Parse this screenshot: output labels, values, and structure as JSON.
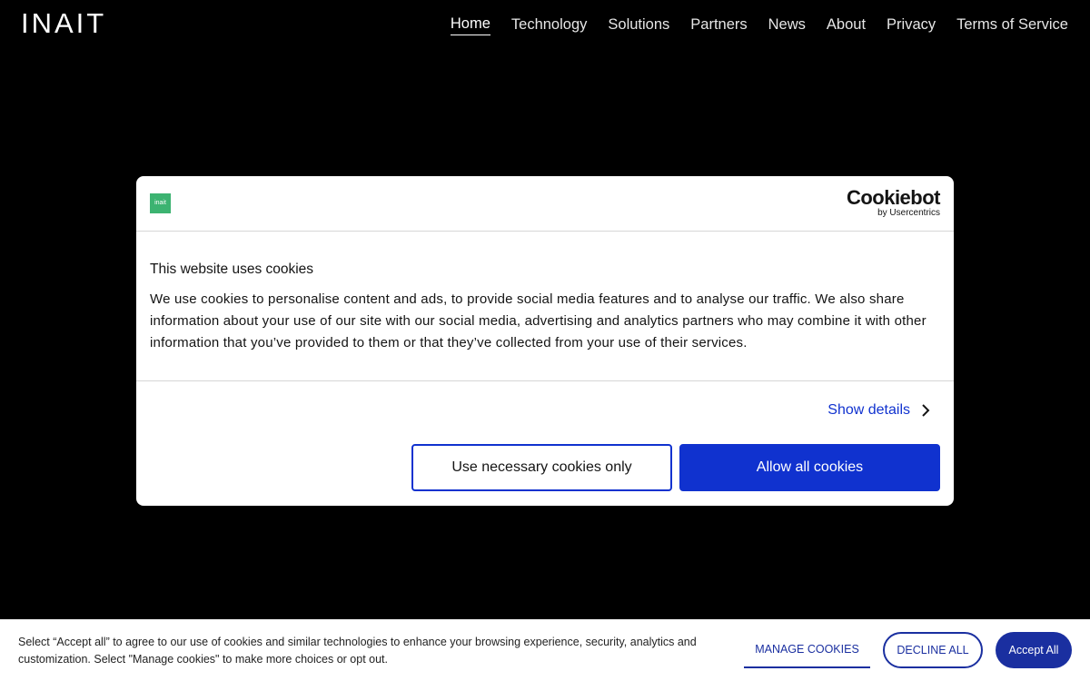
{
  "header": {
    "logo": "INAIT",
    "nav": [
      {
        "label": "Home",
        "active": true
      },
      {
        "label": "Technology"
      },
      {
        "label": "Solutions"
      },
      {
        "label": "Partners"
      },
      {
        "label": "News"
      },
      {
        "label": "About"
      },
      {
        "label": "Privacy"
      },
      {
        "label": "Terms of Service"
      }
    ]
  },
  "dialog": {
    "brand_badge": "inait",
    "provider_logo": "Cookiebot",
    "provider_sub": "by Usercentrics",
    "title": "This website uses cookies",
    "text": "We use cookies to personalise content and ads, to provide social media features and to analyse our traffic. We also share information about your use of our site with our social media, advertising and analytics partners who may combine it with other information that you’ve provided to them or that they’ve collected from your use of their services.",
    "show_details": "Show details",
    "necessary_button": "Use necessary cookies only",
    "allow_button": "Allow all cookies",
    "accent_color": "#1032cf"
  },
  "banner": {
    "text": "Select “Accept all” to agree to our use of cookies and similar technologies to enhance your browsing experience, security, analytics and customization. Select \"Manage cookies\" to make more choices or opt out.",
    "manage": "MANAGE COOKIES",
    "decline": "DECLINE ALL",
    "accept": "Accept All",
    "accent_color": "#1a2fa0"
  }
}
